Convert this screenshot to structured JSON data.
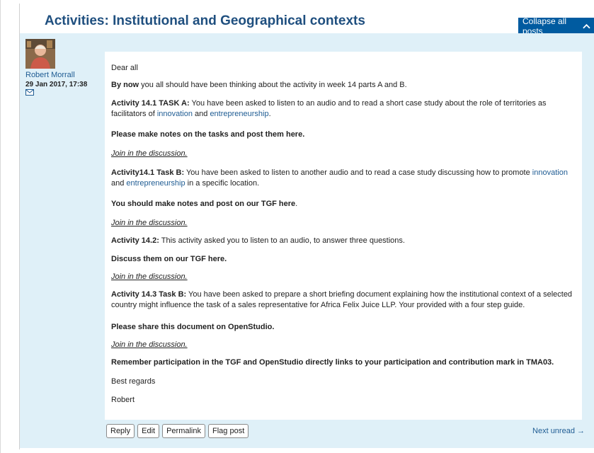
{
  "header": {
    "title": "Activities: Institutional and Geographical contexts",
    "collapse_label": "Collapse all posts"
  },
  "post": {
    "author": "Robert Morrall",
    "date": "29 Jan 2017, 17:38",
    "body": {
      "greeting": "Dear all",
      "p1_bold": "By now",
      "p1_rest": " you all should have been thinking about the activity in week 14 parts A and B.",
      "p2_bold": "Activity 14.1 TASK A:",
      "p2_text_a": " You have been asked to listen to an audio and to read a short case study about the role of territories as facilitators of ",
      "p2_link1": "innovation",
      "p2_and": " and ",
      "p2_link2": "entrepreneurship",
      "p2_end": ".",
      "p3": "Please make notes on the tasks and post them here.",
      "join": "Join in the discussion.",
      "p4_bold": "Activity14.1 Task B:",
      "p4_text_a": " You have been asked to listen to another audio and to read a case study discussing how to promote ",
      "p4_link1": "innovation",
      "p4_and": " and ",
      "p4_link2": "entrepreneurship",
      "p4_end": " in a specific location.",
      "p5_bold": "You should make notes and post on our TGF here",
      "p5_end": ".",
      "p6_bold": "Activity 14.2:",
      "p6_rest": " This activity asked you to listen to an audio, to answer three questions.",
      "p7": "Discuss them on our TGF here.",
      "p8_bold": "Activity 14.3 Task B:",
      "p8_rest": " You have been asked to prepare a short briefing document explaining how the institutional context of a selected country might influence the task of a sales representative for Africa Felix Juice LLP. Your provided with a four step guide.",
      "p9": "Please share this document on OpenStudio.",
      "p10": "Remember participation in the TGF and OpenStudio directly links to your participation and contribution mark in TMA03.",
      "regards": "Best regards",
      "signature": "Robert"
    },
    "actions": [
      "Reply",
      "Edit",
      "Permalink",
      "Flag post"
    ],
    "next_unread": "Next unread →"
  }
}
